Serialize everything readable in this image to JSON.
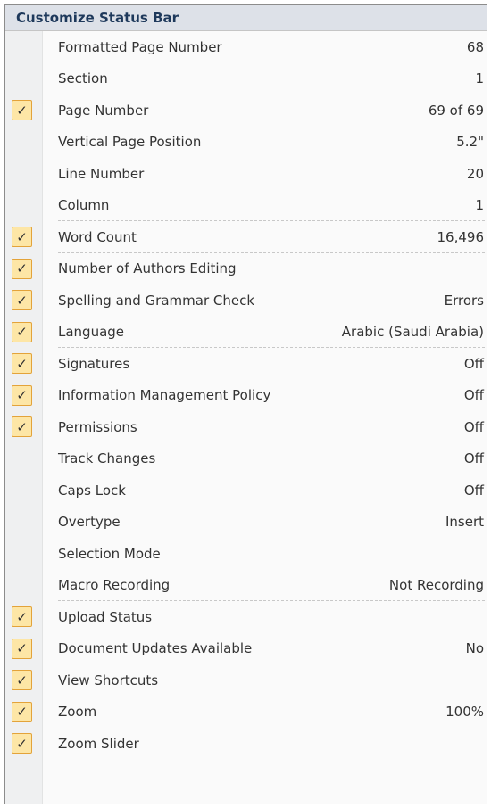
{
  "menu": {
    "title": "Customize Status Bar",
    "items": [
      {
        "label": "Formatted Page Number",
        "value": "68",
        "checked": false,
        "separator_after": false
      },
      {
        "label": "Section",
        "value": "1",
        "checked": false,
        "separator_after": false
      },
      {
        "label": "Page Number",
        "value": "69 of 69",
        "checked": true,
        "separator_after": false
      },
      {
        "label": "Vertical Page Position",
        "value": "5.2\"",
        "checked": false,
        "separator_after": false
      },
      {
        "label": "Line Number",
        "value": "20",
        "checked": false,
        "separator_after": false
      },
      {
        "label": "Column",
        "value": "1",
        "checked": false,
        "separator_after": true
      },
      {
        "label": "Word Count",
        "value": "16,496",
        "checked": true,
        "separator_after": true
      },
      {
        "label": "Number of Authors Editing",
        "value": "",
        "checked": true,
        "separator_after": true
      },
      {
        "label": "Spelling and Grammar Check",
        "value": "Errors",
        "checked": true,
        "separator_after": false
      },
      {
        "label": "Language",
        "value": "Arabic (Saudi Arabia)",
        "checked": true,
        "separator_after": true
      },
      {
        "label": "Signatures",
        "value": "Off",
        "checked": true,
        "separator_after": false
      },
      {
        "label": "Information Management Policy",
        "value": "Off",
        "checked": true,
        "separator_after": false
      },
      {
        "label": "Permissions",
        "value": "Off",
        "checked": true,
        "separator_after": false
      },
      {
        "label": "Track Changes",
        "value": "Off",
        "checked": false,
        "separator_after": true
      },
      {
        "label": "Caps Lock",
        "value": "Off",
        "checked": false,
        "separator_after": false
      },
      {
        "label": "Overtype",
        "value": "Insert",
        "checked": false,
        "separator_after": false
      },
      {
        "label": "Selection Mode",
        "value": "",
        "checked": false,
        "separator_after": false
      },
      {
        "label": "Macro Recording",
        "value": "Not Recording",
        "checked": false,
        "separator_after": true
      },
      {
        "label": "Upload Status",
        "value": "",
        "checked": true,
        "separator_after": false
      },
      {
        "label": "Document Updates Available",
        "value": "No",
        "checked": true,
        "separator_after": true
      },
      {
        "label": "View Shortcuts",
        "value": "",
        "checked": true,
        "separator_after": false
      },
      {
        "label": "Zoom",
        "value": "100%",
        "checked": true,
        "separator_after": false
      },
      {
        "label": "Zoom Slider",
        "value": "",
        "checked": true,
        "separator_after": false
      }
    ]
  },
  "check_glyph": "✓",
  "icons": {
    "check": "checkmark-icon"
  },
  "colors": {
    "header_background": "#dde1e8",
    "header_text": "#1e395b",
    "check_fill": "#fde6a6",
    "check_border": "#e3a33a",
    "text": "#333333"
  }
}
